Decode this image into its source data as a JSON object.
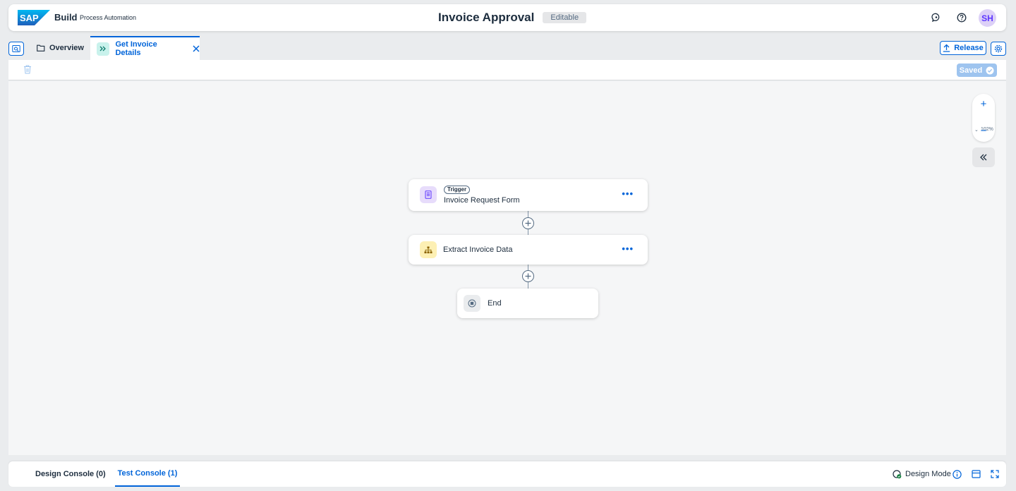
{
  "shell": {
    "logo_text": "SAP",
    "brand": "Build",
    "product": "Process Automation",
    "title": "Invoice Approval",
    "status_badge": "Editable",
    "avatar_initials": "SH"
  },
  "tabs": {
    "overview_label": "Overview",
    "active_label": "Get Invoice Details"
  },
  "actions": {
    "release_label": "Release",
    "saved_label": "Saved"
  },
  "zoom": {
    "level": "102%"
  },
  "flow": {
    "trigger": {
      "tag": "Trigger",
      "label": "Invoice Request Form"
    },
    "step": {
      "label": "Extract Invoice Data"
    },
    "end": {
      "label": "End"
    }
  },
  "console": {
    "design_tab": "Design Console (0)",
    "test_tab": "Test Console (1)",
    "mode_label": "Design Mode"
  },
  "colors": {
    "accent": "#0064d9",
    "trigger_icon_bg": "#e7dcfb",
    "step_icon_bg": "#fdf0b4",
    "end_icon_bg": "#eaecee"
  }
}
